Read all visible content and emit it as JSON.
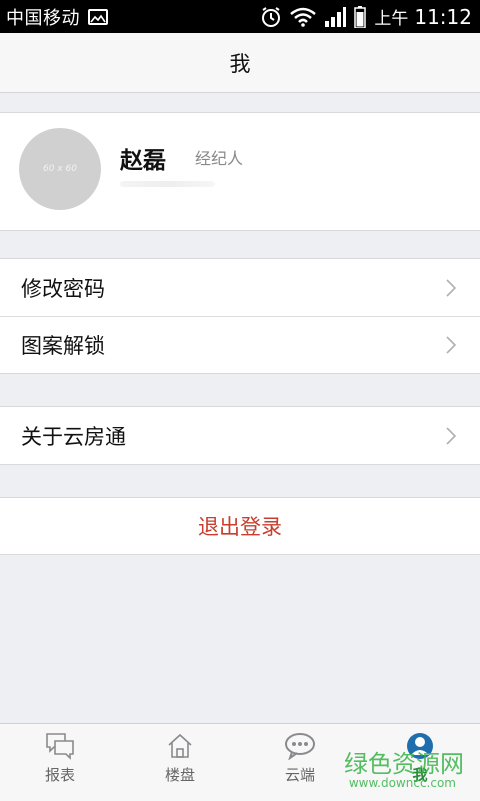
{
  "status_bar": {
    "carrier": "中国移动",
    "ampm": "上午",
    "time": "11:12",
    "icons": [
      "image-icon",
      "alarm-icon",
      "wifi-icon",
      "signal-icon",
      "battery-icon"
    ]
  },
  "header": {
    "title": "我"
  },
  "profile": {
    "avatar_text": "60 x 60",
    "name": "赵磊",
    "role": "经纪人"
  },
  "menu": {
    "change_password": "修改密码",
    "pattern_unlock": "图案解锁",
    "about": "关于云房通"
  },
  "logout": {
    "label": "退出登录"
  },
  "tabs": [
    {
      "label": "报表",
      "icon": "chat-report-icon"
    },
    {
      "label": "楼盘",
      "icon": "home-icon"
    },
    {
      "label": "云端",
      "icon": "cloud-chat-icon"
    },
    {
      "label": "我",
      "icon": "user-icon"
    }
  ],
  "watermark": {
    "text": "绿色资源网",
    "sub": "www.downcc.com"
  },
  "colors": {
    "accent": "#2a8a3a",
    "logout": "#c83e2e",
    "background": "#eeeff2"
  }
}
